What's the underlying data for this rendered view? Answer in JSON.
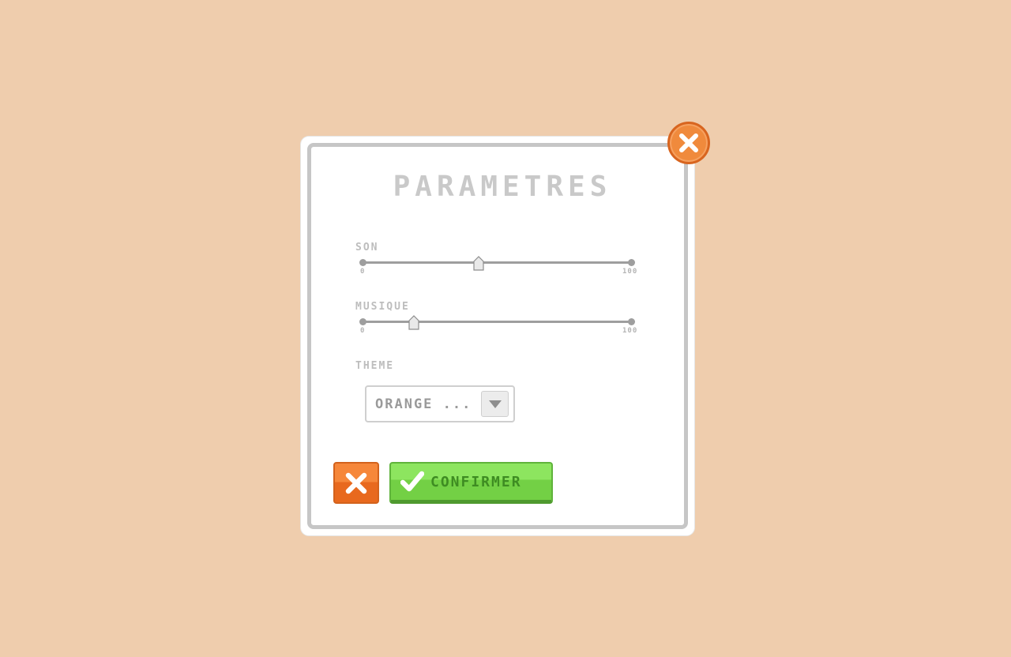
{
  "dialog": {
    "title": "PARAMETRES"
  },
  "sound": {
    "label": "SON",
    "min_label": "0",
    "max_label": "100",
    "value": 43
  },
  "music": {
    "label": "MUSIQUE",
    "min_label": "0",
    "max_label": "100",
    "value": 19
  },
  "theme": {
    "label": "THEME",
    "selected": "ORANGE ..."
  },
  "buttons": {
    "confirm_label": "CONFIRMER"
  },
  "colors": {
    "background": "#efcdad",
    "accent_orange": "#f08a3c",
    "accent_green": "#73d045",
    "frame_gray": "#c6c6c6"
  },
  "icons": {
    "close": "close-icon",
    "cancel": "close-icon",
    "confirm": "check-icon",
    "dropdown": "chevron-down-icon"
  }
}
